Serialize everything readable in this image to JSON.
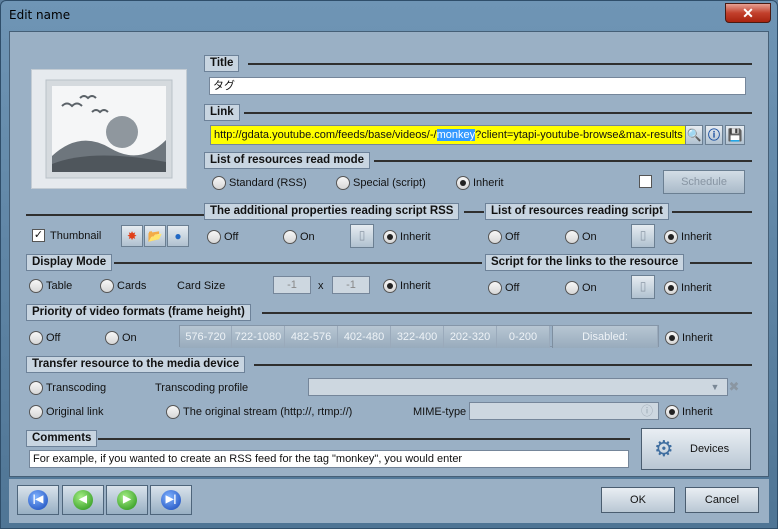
{
  "window": {
    "title": "Edit name",
    "close_glyph": "✕"
  },
  "sections": {
    "title": "Title",
    "link": "Link",
    "read_mode": "List of resources read mode",
    "additional_props": "The additional properties reading script RSS",
    "reading_script": "List of resources reading script",
    "display_mode": "Display Mode",
    "links_script": "Script for the links to the resource",
    "priority": "Priority of video formats (frame height)",
    "transfer": "Transfer resource to the media device",
    "comments": "Comments"
  },
  "fields": {
    "title_value": "タグ",
    "link_before": "http://gdata.youtube.com/feeds/base/videos/-/",
    "link_highlight": "monkey",
    "link_after": "?client=ytapi-youtube-browse&max-results",
    "comment_value": "For example, if you wanted to create an RSS feed for the tag \"monkey\", you would enter",
    "card_w": "-1",
    "card_h": "-1",
    "transcoding_profile_value": "",
    "mime_value": ""
  },
  "read_mode": {
    "standard": "Standard (RSS)",
    "special": "Special (script)",
    "inherit": "Inherit",
    "selected": "inherit",
    "schedule": "Schedule"
  },
  "thumbnail": {
    "label": "Thumbnail",
    "checked": true,
    "icons": [
      "burst-icon",
      "folder-icon",
      "globe-icon"
    ]
  },
  "common": {
    "off": "Off",
    "on": "On",
    "inherit": "Inherit"
  },
  "display_mode": {
    "table": "Table",
    "cards": "Cards",
    "card_size": "Card Size",
    "x": "x"
  },
  "priority": {
    "formats": [
      "576-720",
      "722-1080",
      "482-576",
      "402-480",
      "322-400",
      "202-320",
      "0-200"
    ],
    "disabled": "Disabled:"
  },
  "transfer": {
    "transcoding": "Transcoding",
    "profile_label": "Transcoding profile",
    "original_link": "Original link",
    "original_stream": "The original stream (http://, rtmp://)",
    "mime_label": "MIME-type",
    "inherit": "Inherit"
  },
  "buttons": {
    "devices": "Devices",
    "ok": "OK",
    "cancel": "Cancel"
  },
  "colors": {
    "link_bg": "#ffff00",
    "highlight": "#3399ff",
    "panel": "#9ab0c5"
  }
}
